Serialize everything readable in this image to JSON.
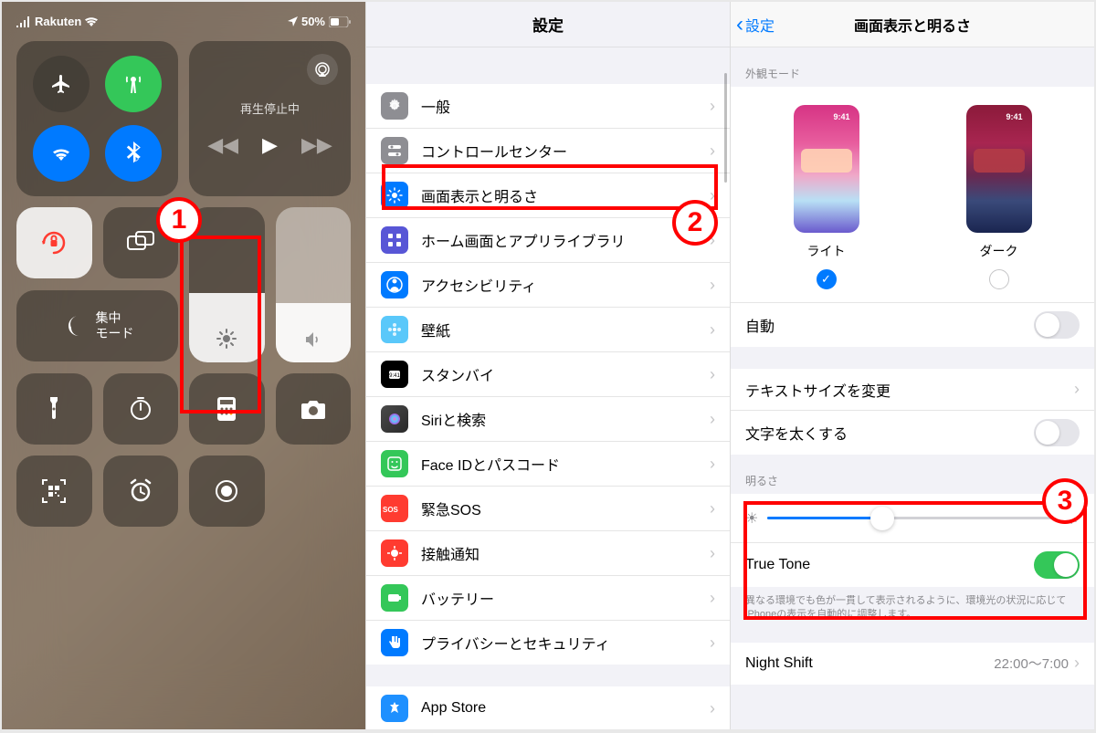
{
  "panel1": {
    "carrier": "Rakuten",
    "battery": "50%",
    "media_title": "再生停止中",
    "focus_label": "集中\nモード"
  },
  "panel2": {
    "title": "設定",
    "items": [
      {
        "label": "一般",
        "color": "ic-gray",
        "glyph": "gear"
      },
      {
        "label": "コントロールセンター",
        "color": "ic-gray2",
        "glyph": "switches"
      },
      {
        "label": "画面表示と明るさ",
        "color": "ic-blue",
        "glyph": "sun"
      },
      {
        "label": "ホーム画面とアプリライブラリ",
        "color": "ic-purple",
        "glyph": "grid"
      },
      {
        "label": "アクセシビリティ",
        "color": "ic-blue",
        "glyph": "person"
      },
      {
        "label": "壁紙",
        "color": "ic-teal",
        "glyph": "flower"
      },
      {
        "label": "スタンバイ",
        "color": "ic-black",
        "glyph": "clock"
      },
      {
        "label": "Siriと検索",
        "color": "ic-siri",
        "glyph": "siri"
      },
      {
        "label": "Face IDとパスコード",
        "color": "ic-green",
        "glyph": "face"
      },
      {
        "label": "緊急SOS",
        "color": "ic-red",
        "glyph": "sos"
      },
      {
        "label": "接触通知",
        "color": "ic-red2",
        "glyph": "virus"
      },
      {
        "label": "バッテリー",
        "color": "ic-battery",
        "glyph": "battery"
      },
      {
        "label": "プライバシーとセキュリティ",
        "color": "ic-hand",
        "glyph": "hand"
      }
    ],
    "appstore": "App Store"
  },
  "panel3": {
    "back": "設定",
    "title": "画面表示と明るさ",
    "appearance_label": "外観モード",
    "light": "ライト",
    "dark": "ダーク",
    "thumb_time": "9:41",
    "auto": "自動",
    "textsize": "テキストサイズを変更",
    "boldtext": "文字を太くする",
    "brightness_label": "明るさ",
    "truetone": "True Tone",
    "truetone_note": "異なる環境でも色が一貫して表示されるように、環境光の状況に応じてiPhoneの表示を自動的に調整します。",
    "nightshift": "Night Shift",
    "nightshift_val": "22:00〜7:00"
  },
  "annotations": {
    "b1": "1",
    "b2": "2",
    "b3": "3"
  }
}
